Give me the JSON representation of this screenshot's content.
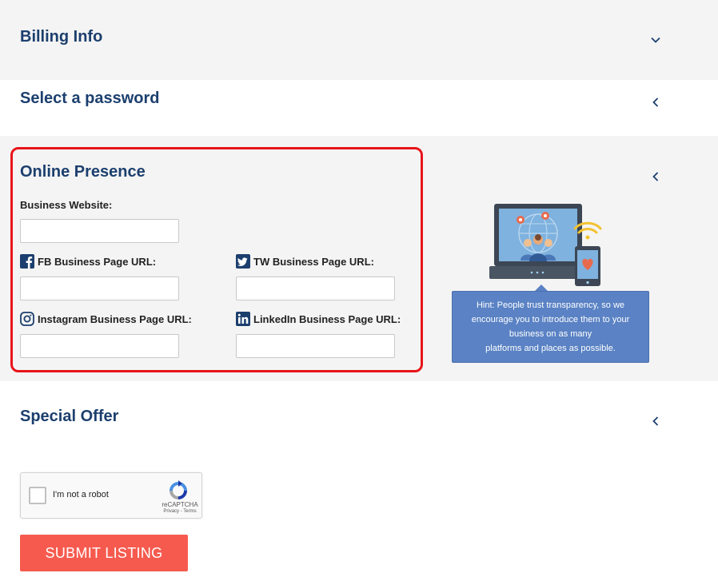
{
  "sections": {
    "billing": {
      "title": "Billing Info",
      "chevron": "chevron-down-icon"
    },
    "password": {
      "title": "Select a password",
      "chevron": "chevron-left-icon"
    },
    "online": {
      "title": "Online Presence",
      "chevron": "chevron-left-icon",
      "fields": {
        "website": {
          "label": "Business Website:",
          "value": ""
        },
        "facebook": {
          "label": "FB Business Page URL:",
          "icon": "facebook-icon",
          "value": ""
        },
        "twitter": {
          "label": "TW Business Page URL:",
          "icon": "twitter-icon",
          "value": ""
        },
        "instagram": {
          "label": "Instagram Business Page URL:",
          "icon": "instagram-icon",
          "value": ""
        },
        "linkedin": {
          "label": "LinkedIn Business Page URL:",
          "icon": "linkedin-icon",
          "value": ""
        }
      },
      "hint": {
        "line1": "Hint: People trust transparency, so we",
        "line2": "encourage you to introduce them to your",
        "line3": "business on as many",
        "line4": "platforms and places as possible."
      }
    },
    "special": {
      "title": "Special Offer",
      "chevron": "chevron-left-icon"
    }
  },
  "recaptcha": {
    "label": "I'm not a robot",
    "brand": "reCAPTCHA",
    "terms": "Privacy - Terms"
  },
  "submit": {
    "label": "SUBMIT LISTING"
  },
  "colors": {
    "title": "#1c3f6e",
    "highlight": "#e8141a",
    "hint_bg": "#5a82c4",
    "submit_bg": "#f65a4e",
    "section_bg": "#f4f4f4"
  }
}
